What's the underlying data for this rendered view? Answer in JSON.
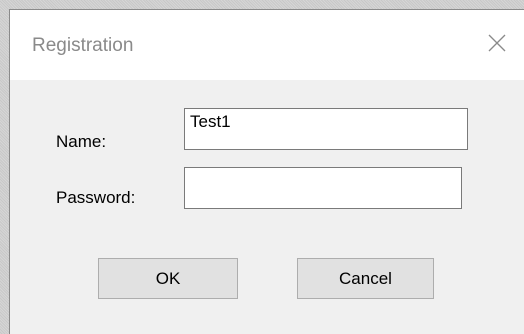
{
  "window": {
    "title": "Registration",
    "close_icon": "close-icon"
  },
  "form": {
    "name_label": "Name:",
    "name_value": "Test1",
    "password_label": "Password:",
    "password_value": ""
  },
  "buttons": {
    "ok_label": "OK",
    "cancel_label": "Cancel"
  },
  "colors": {
    "title_text": "#8a8a8a",
    "titlebar_bg": "#ffffff",
    "dialog_bg": "#f0f0f0",
    "button_bg": "#e1e1e1"
  }
}
